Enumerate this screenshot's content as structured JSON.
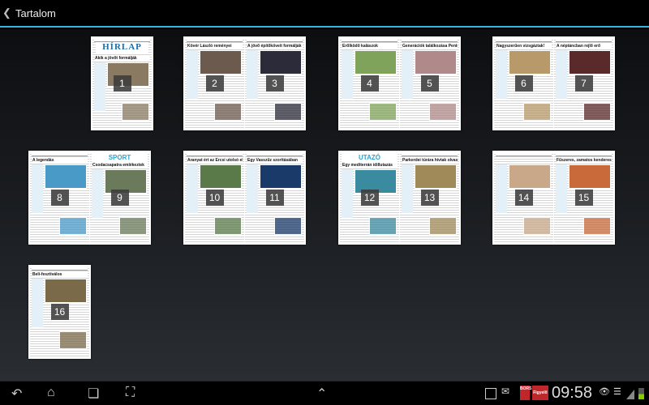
{
  "header": {
    "back_icon": "chevron-left-icon",
    "title": "Tartalom"
  },
  "items": [
    {
      "pages": [
        {
          "num": "1",
          "masthead": "HÍRLAP",
          "headline": "Akik a jövőt formálják",
          "photo": "#8a7a62"
        }
      ]
    },
    {
      "pages": [
        {
          "num": "2",
          "headline": "Kövér László reményei",
          "photo": "#6d5a4e"
        },
        {
          "num": "3",
          "headline": "A jövő építőköveit formálják",
          "photo": "#2b2b3a"
        }
      ]
    },
    {
      "pages": [
        {
          "num": "4",
          "headline": "Erőlködő kalászok",
          "photo": "#7fa35a"
        },
        {
          "num": "5",
          "headline": "Generációk találkozása Pentelén",
          "photo": "#b08a8a"
        }
      ]
    },
    {
      "pages": [
        {
          "num": "6",
          "headline": "Nagyszerűen vizsgáztak!",
          "photo": "#b89a6a"
        },
        {
          "num": "7",
          "headline": "A néptáncban rejlő erő",
          "photo": "#5a2a2a"
        }
      ]
    },
    {
      "pages": [
        {
          "num": "8",
          "headline": "A legendás",
          "photo": "#4a9ac8"
        },
        {
          "num": "9",
          "section": "SPORT",
          "headline": "Csodacsapatra emlékeztek",
          "photo": "#6a7a5a"
        }
      ]
    },
    {
      "pages": [
        {
          "num": "10",
          "headline": "Aranyat ért az Ercsi utolsó előtte",
          "photo": "#5a7a4a"
        },
        {
          "num": "11",
          "headline": "Egy Vasszűz szorításában",
          "photo": "#1a3a6a"
        }
      ]
    },
    {
      "pages": [
        {
          "num": "12",
          "section": "UTAZÓ",
          "headline": "Egy mediterrán idillutazás",
          "photo": "#3a8aa0"
        },
        {
          "num": "13",
          "headline": "Parkerdei túrára hívtak olvasóinkat",
          "photo": "#a08a5a"
        }
      ]
    },
    {
      "pages": [
        {
          "num": "14",
          "headline": "",
          "photo": "#c8a888"
        },
        {
          "num": "15",
          "headline": "Fűszeres, zamatos kenderes",
          "photo": "#c86a3a"
        }
      ]
    },
    {
      "pages": [
        {
          "num": "16",
          "headline": "Beli-fesztiválos",
          "photo": "#7a6a4a"
        }
      ]
    }
  ],
  "navbar": {
    "back_icon": "back-icon",
    "home_icon": "home-icon",
    "recent_icon": "recent-apps-icon",
    "screenshot_icon": "screenshot-icon",
    "up_icon": "chevron-up-icon"
  },
  "status": {
    "badge1": "BORS",
    "badge2": "Figyelő",
    "time": "09:58"
  }
}
